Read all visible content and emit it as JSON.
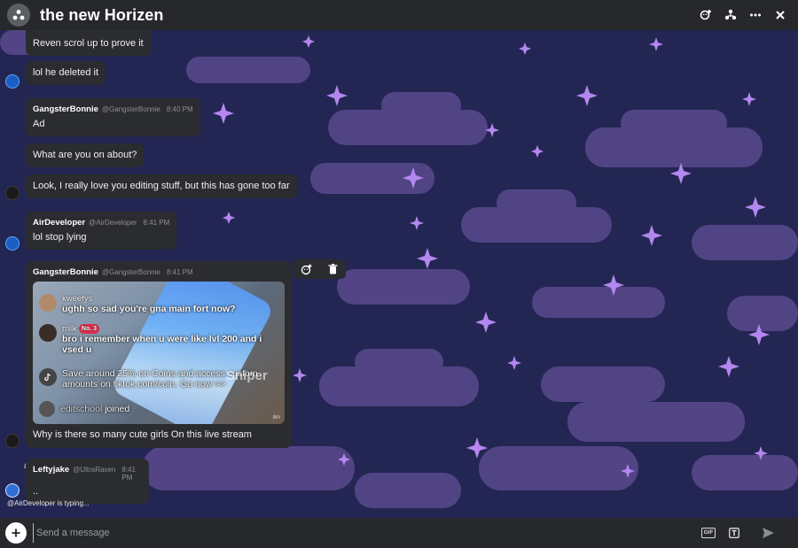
{
  "header": {
    "title": "the new Horizen",
    "icons": [
      "group-icon",
      "add-member-icon",
      "members-icon",
      "more-icon",
      "close-icon"
    ]
  },
  "messages": [
    {
      "id": "m0",
      "author": "",
      "handle": "",
      "time": "",
      "text": "Reven scrol up to prove it"
    },
    {
      "id": "m1",
      "author": "",
      "handle": "",
      "time": "",
      "text": "lol he deleted it"
    },
    {
      "id": "m2",
      "author": "GangsterBonnie",
      "handle": "@GangsterBonnie",
      "time": "8:40 PM",
      "text": "Ad"
    },
    {
      "id": "m3",
      "author": "",
      "handle": "",
      "time": "",
      "text": "What are you on about?"
    },
    {
      "id": "m4",
      "author": "",
      "handle": "",
      "time": "",
      "text": "Look, I really love you editing stuff, but this has gone too far"
    },
    {
      "id": "m5",
      "author": "AirDeveloper",
      "handle": "@AirDeveloper",
      "time": "8:41 PM",
      "text": "lol stop lying"
    },
    {
      "id": "m6",
      "author": "GangsterBonnie",
      "handle": "@GangsterBonnie",
      "time": "8:41 PM",
      "text": "Why is there so many cute girls On this live stream"
    },
    {
      "id": "m7",
      "author": "Leftyjake",
      "handle": "@UltraRaven",
      "time": "8:41 PM",
      "text": ".."
    }
  ],
  "media": {
    "rows": [
      {
        "name": "kweefys",
        "text": "ughh so sad you're gna main fort now?"
      },
      {
        "name": "milk",
        "badge": "No. 3",
        "text": "bro i remember when u were like lvl 200 and i vsed u"
      },
      {
        "name": "",
        "text": "Save around 25% on Coins and access custom amounts on tiktok.com/coin. Go now >>"
      },
      {
        "name": "editschool",
        "text": "joined"
      }
    ],
    "watermark": "Sniper",
    "corner": "8m"
  },
  "message_actions": [
    "add-reaction-icon",
    "delete-icon"
  ],
  "typing": "@AirDeveloper is typing...",
  "composer": {
    "placeholder": "Send a message",
    "gif_label": "GIF",
    "icons": [
      "plus-icon",
      "gif-icon",
      "text-format-icon",
      "send-icon"
    ]
  },
  "colors": {
    "header": "#26282b",
    "bubble": "#2b2c2f",
    "background": "#232652",
    "cloud": "#5c4a8f",
    "sparkle": "#b487f0"
  }
}
